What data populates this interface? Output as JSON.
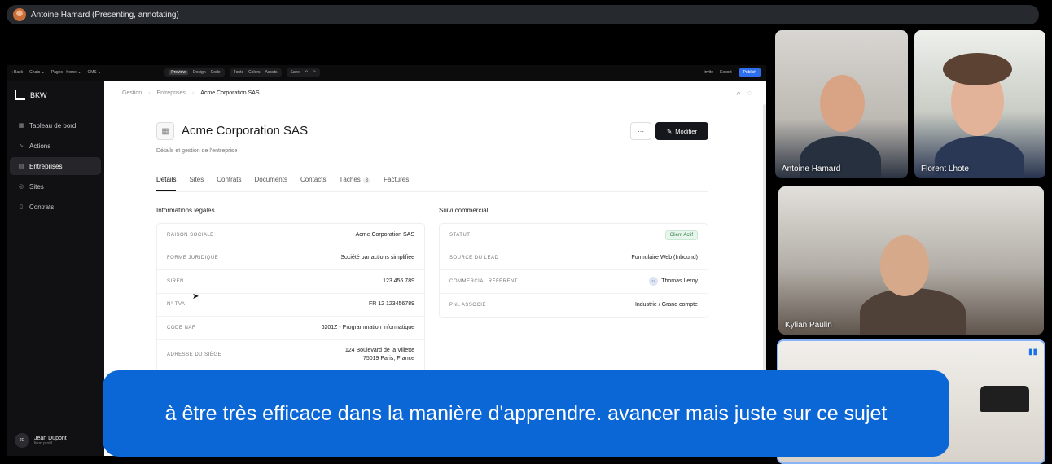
{
  "presenter": {
    "label": "Antoine Hamard (Presenting, annotating)"
  },
  "toolbar": {
    "back": "‹ Back",
    "chats": "Chats ⌄",
    "pages": "Pages - home ⌄",
    "cms": "CMS ⌄",
    "preview": "Preview",
    "design": "Design",
    "code": "Code",
    "fonts": "Fonts",
    "colors": "Colors",
    "assets": "Assets",
    "save": "Save",
    "invite": "Invite",
    "export": "Export",
    "publish": "Publish"
  },
  "sidebar": {
    "brand": "BKW",
    "items": [
      {
        "label": "Tableau de bord",
        "icon": "grid-icon"
      },
      {
        "label": "Actions",
        "icon": "pulse-icon"
      },
      {
        "label": "Entreprises",
        "icon": "building-icon"
      },
      {
        "label": "Sites",
        "icon": "pin-icon"
      },
      {
        "label": "Contrats",
        "icon": "file-icon"
      }
    ],
    "profile": {
      "initials": "JD",
      "name": "Jean Dupont",
      "subtitle": "Mon profil"
    }
  },
  "breadcrumb": {
    "items": [
      "Gestion",
      "Entreprises",
      "Acme Corporation SAS"
    ]
  },
  "page": {
    "title": "Acme Corporation SAS",
    "subtitle": "Détails et gestion de l'entreprise",
    "more_label": "···",
    "edit_label": "Modifier"
  },
  "tabs": [
    {
      "label": "Détails"
    },
    {
      "label": "Sites"
    },
    {
      "label": "Contrats"
    },
    {
      "label": "Documents"
    },
    {
      "label": "Contacts"
    },
    {
      "label": "Tâches",
      "count": "3"
    },
    {
      "label": "Factures"
    }
  ],
  "legal": {
    "title": "Informations légales",
    "rows": [
      {
        "label": "Raison sociale",
        "value": "Acme Corporation SAS"
      },
      {
        "label": "Forme juridique",
        "value": "Société par actions simplifiée"
      },
      {
        "label": "SIREN",
        "value": "123 456 789"
      },
      {
        "label": "N° TVA",
        "value": "FR 12 123456789"
      },
      {
        "label": "Code NAF",
        "value": "6201Z - Programmation informatique"
      },
      {
        "label": "Adresse du siège",
        "value_line1": "124 Boulevard de la Villette",
        "value_line2": "75019 Paris, France"
      }
    ]
  },
  "commercial": {
    "title": "Suivi commercial",
    "rows": [
      {
        "label": "Statut",
        "value": "Client Actif"
      },
      {
        "label": "Source du lead",
        "value": "Formulaire Web (Inbound)"
      },
      {
        "label": "Commercial référent",
        "initials": "TL",
        "value": "Thomas Leroy"
      },
      {
        "label": "PNL associé",
        "value": "Industrie / Grand compte"
      }
    ]
  },
  "participants": [
    {
      "name": "Antoine Hamard"
    },
    {
      "name": "Florent Lhote"
    },
    {
      "name": "Kylian Paulin"
    }
  ],
  "caption": {
    "text": "à être très efficace dans la manière d'apprendre. avancer mais juste sur ce sujet"
  },
  "colors": {
    "caption_bg": "#0b66d6",
    "publish": "#2f6fed",
    "status_green": "#2e7d4a"
  }
}
